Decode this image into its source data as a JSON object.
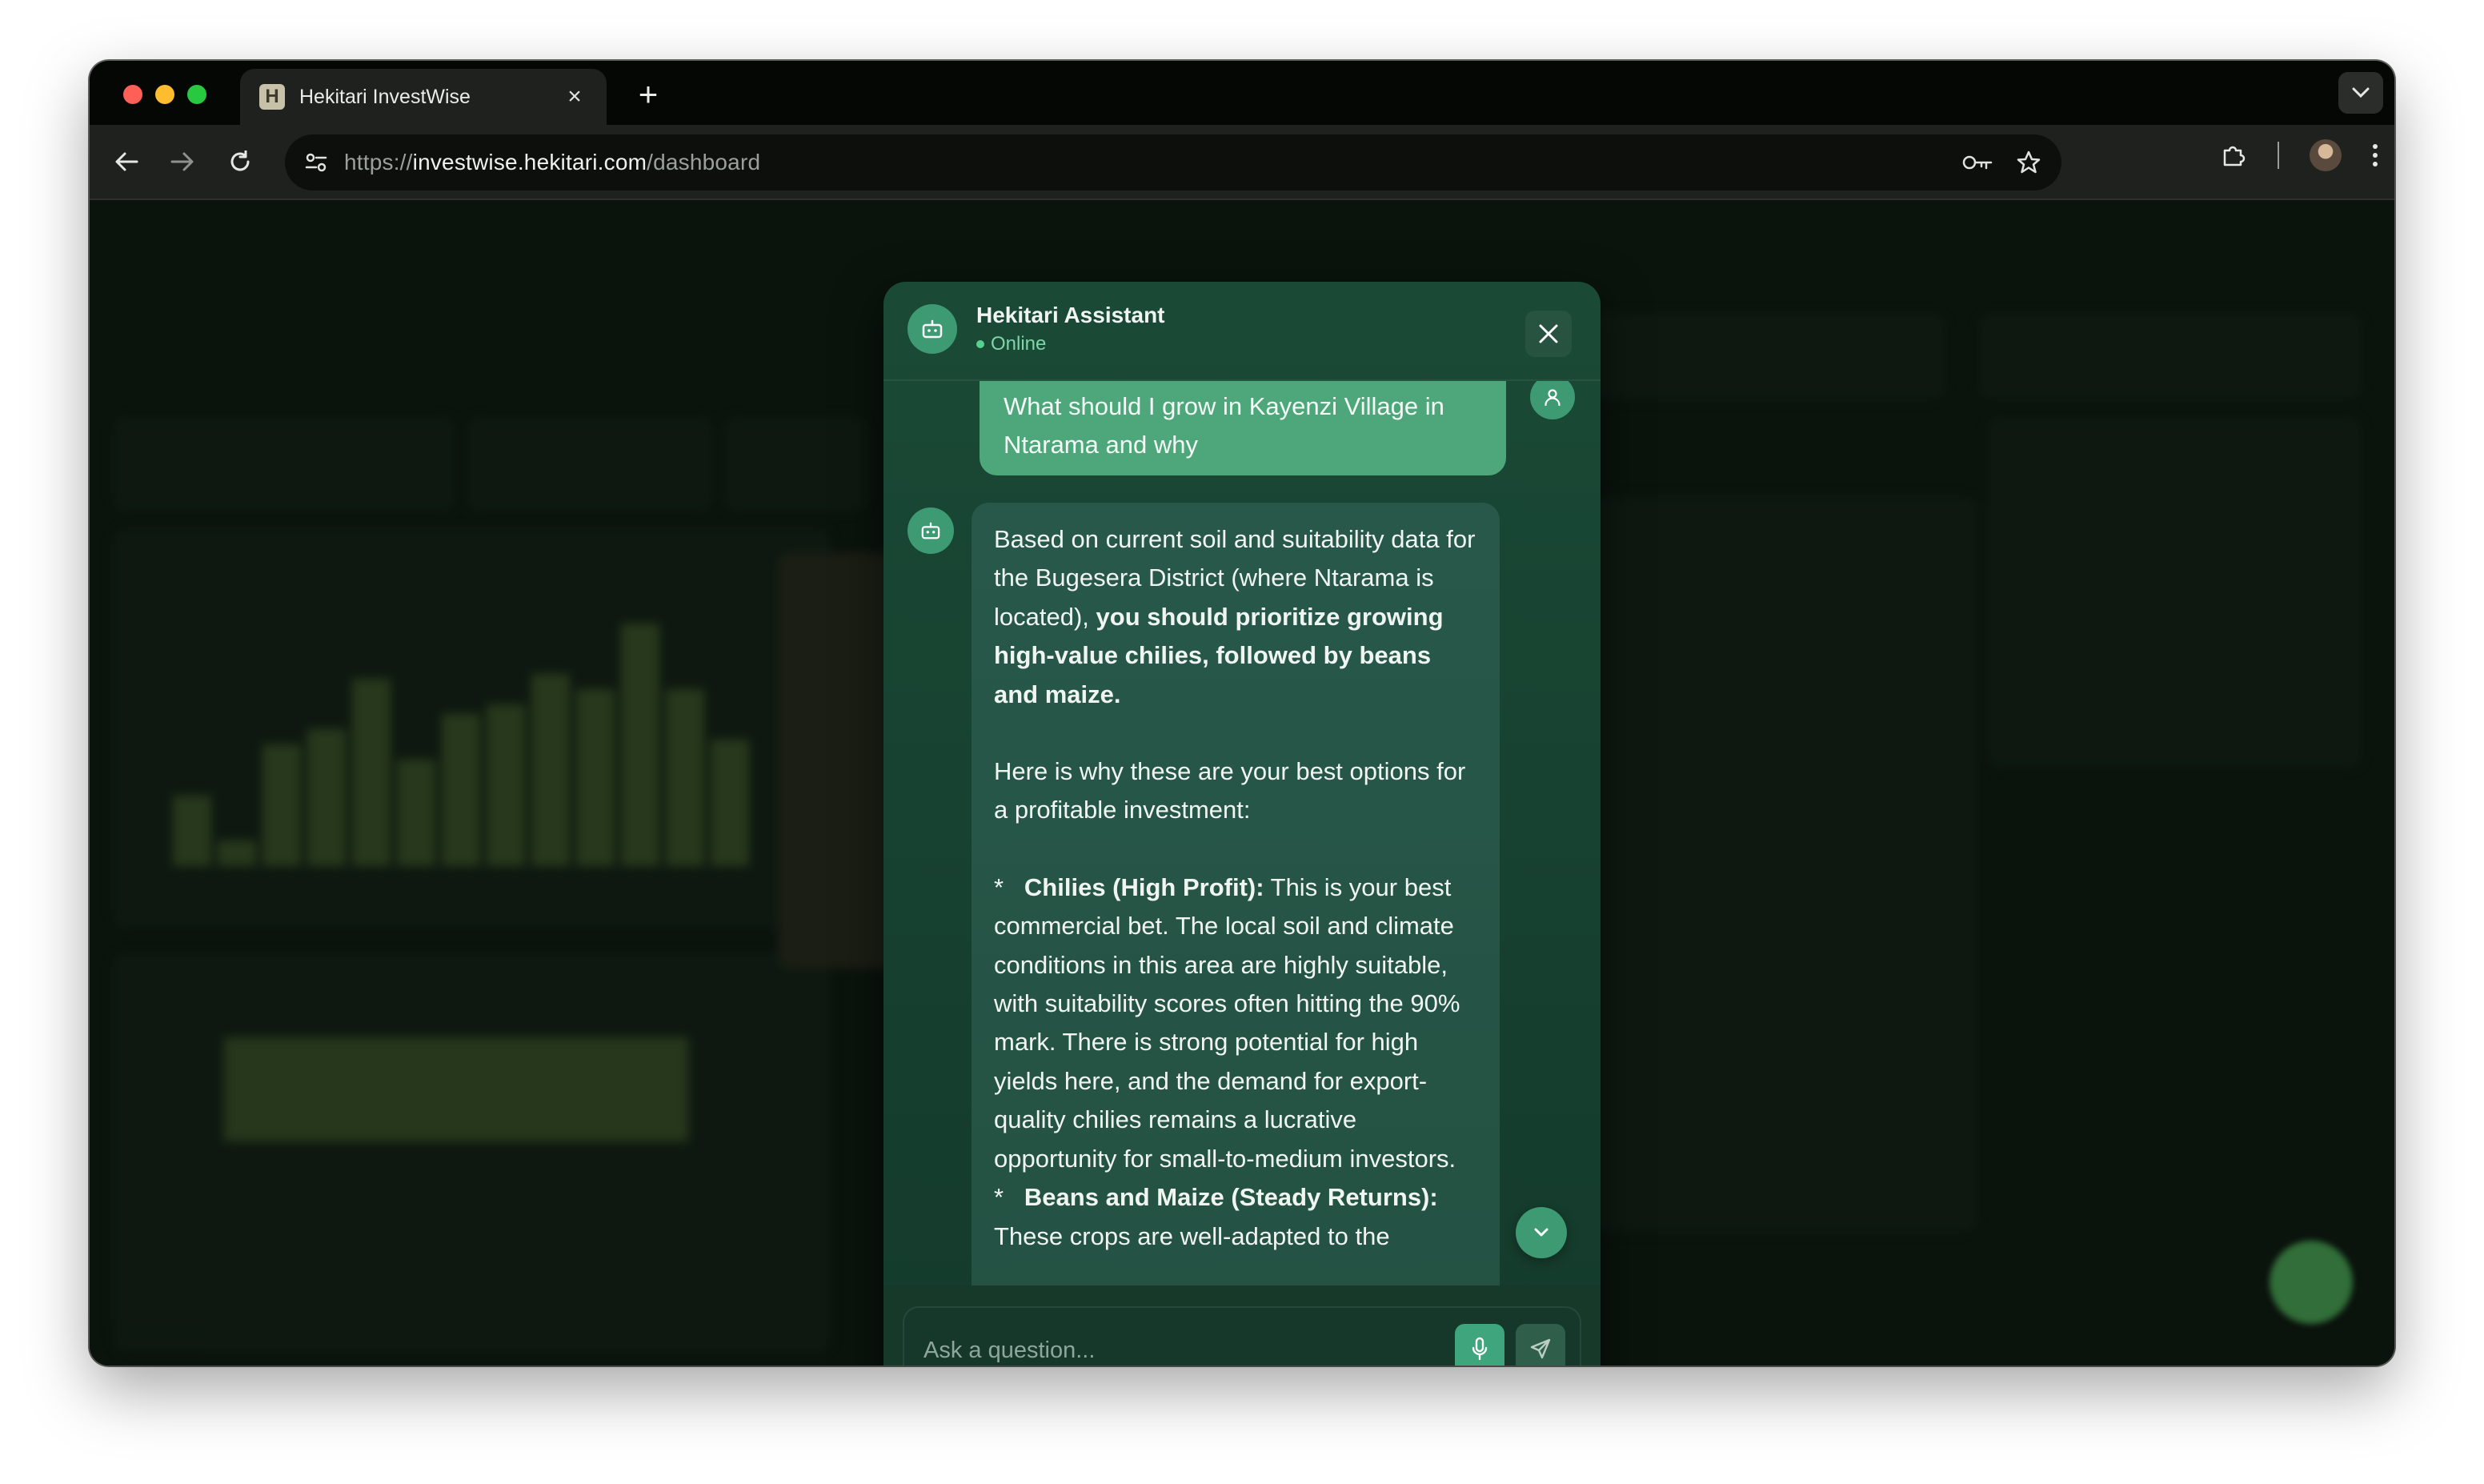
{
  "browser": {
    "tab_title": "Hekitari InvestWise",
    "tab_favicon_letter": "H",
    "new_tab_symbol": "+",
    "url_scheme": "https://",
    "url_host": "investwise.hekitari.com",
    "url_path": "/dashboard"
  },
  "chat": {
    "assistant_name": "Hekitari Assistant",
    "status": "Online",
    "user_message": "What should I grow in Kayenzi Village in Ntarama and why",
    "bot_message": {
      "p1_intro": "Based on current soil and suitability data for the Bugesera District (where Ntarama is located), ",
      "p1_bold": "you should prioritize growing high-value chilies, followed by beans and maize.",
      "p2": "Here is why these are your best options for a profitable investment:",
      "bullet_marker": "*",
      "b1_bold": "Chilies (High Profit):",
      "b1_text": " This is your best commercial bet. The local soil and climate conditions in this area are highly suitable, with suitability scores often hitting the 90% mark. There is strong potential for high yields here, and the demand for export-quality chilies remains a lucrative opportunity for small-to-medium investors.",
      "b2_bold": "Beans and Maize (Steady Returns):",
      "b2_text": " These crops are well-adapted to the"
    },
    "input_placeholder": "Ask a question..."
  },
  "colors": {
    "accent": "#3e9a73",
    "user_bubble": "#4ea77b",
    "bot_bubble": "#27584a",
    "modal_bg": "#1a4a36",
    "online": "#56d18f"
  },
  "icons": {
    "bot": "robot-icon",
    "user": "user-icon",
    "close": "close-icon",
    "scroll": "chevron-down-icon",
    "mic": "microphone-icon",
    "send": "send-icon"
  }
}
